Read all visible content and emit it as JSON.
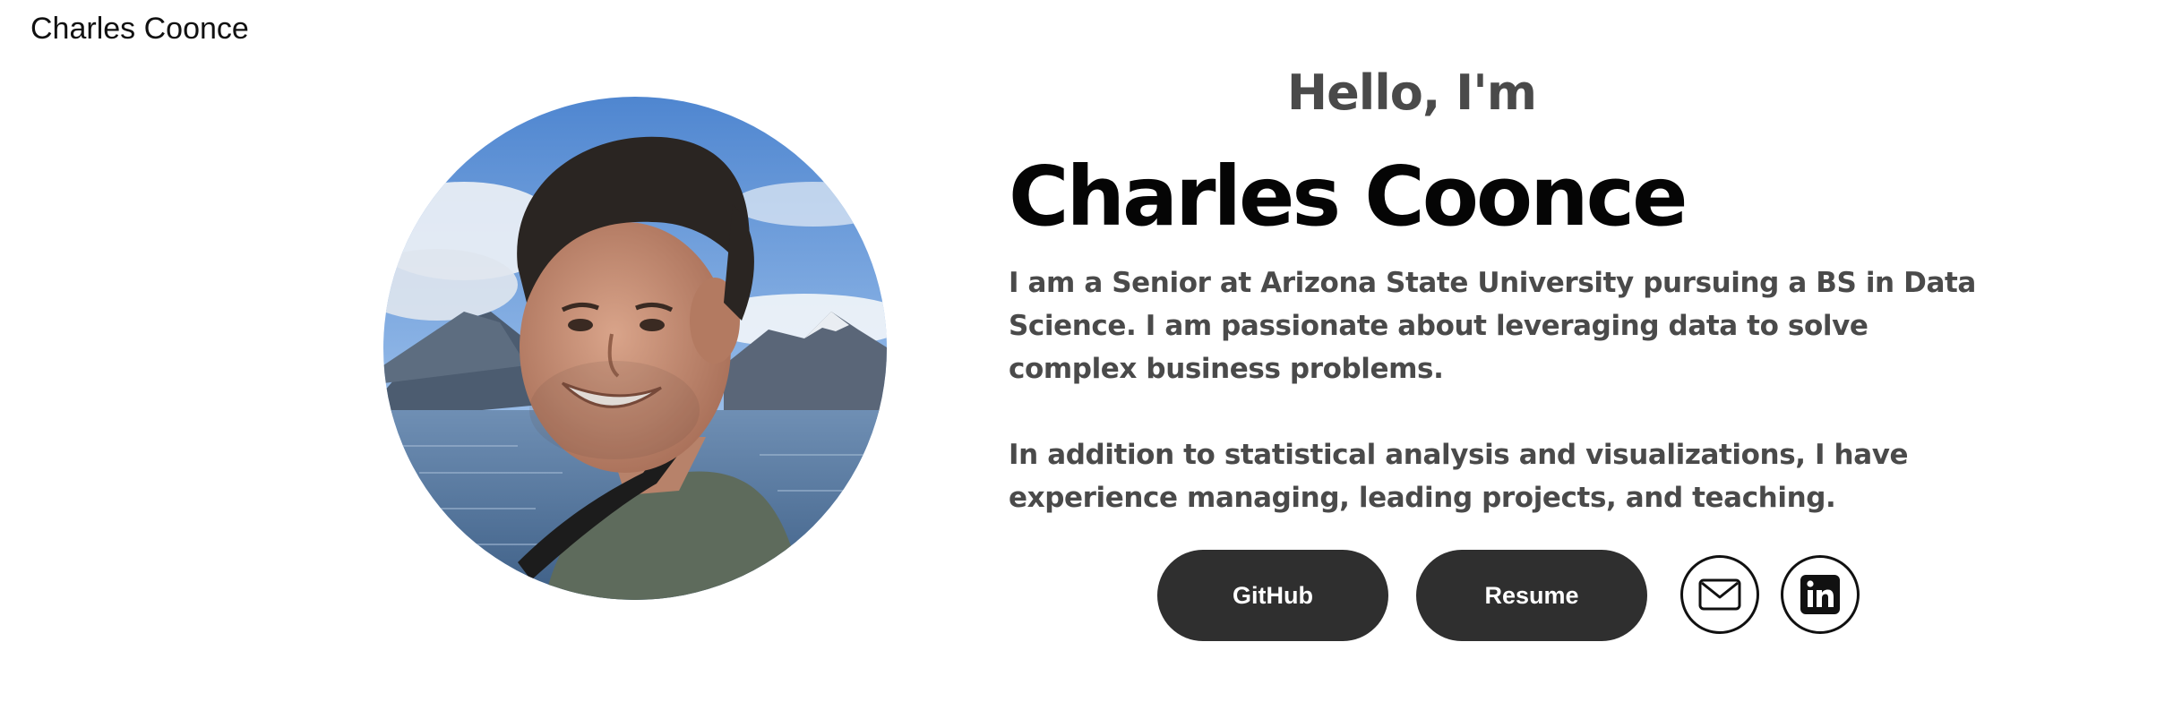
{
  "header": {
    "brand": "Charles Coonce"
  },
  "hero": {
    "greeting": "Hello, I'm",
    "name": "Charles Coonce",
    "bio_paragraph_1": "I am a Senior at Arizona State University pursuing a BS in Data Science. I am passionate about leveraging data to solve complex business problems.",
    "bio_paragraph_2": "In addition to statistical analysis and visualizations, I have experience managing, leading projects, and teaching."
  },
  "actions": {
    "github_label": "GitHub",
    "resume_label": "Resume",
    "email_icon": "mail-icon",
    "linkedin_icon": "linkedin-icon"
  },
  "colors": {
    "button_bg": "#2f2f2f",
    "heading_text": "#050505",
    "body_text": "#4a4a4a"
  }
}
